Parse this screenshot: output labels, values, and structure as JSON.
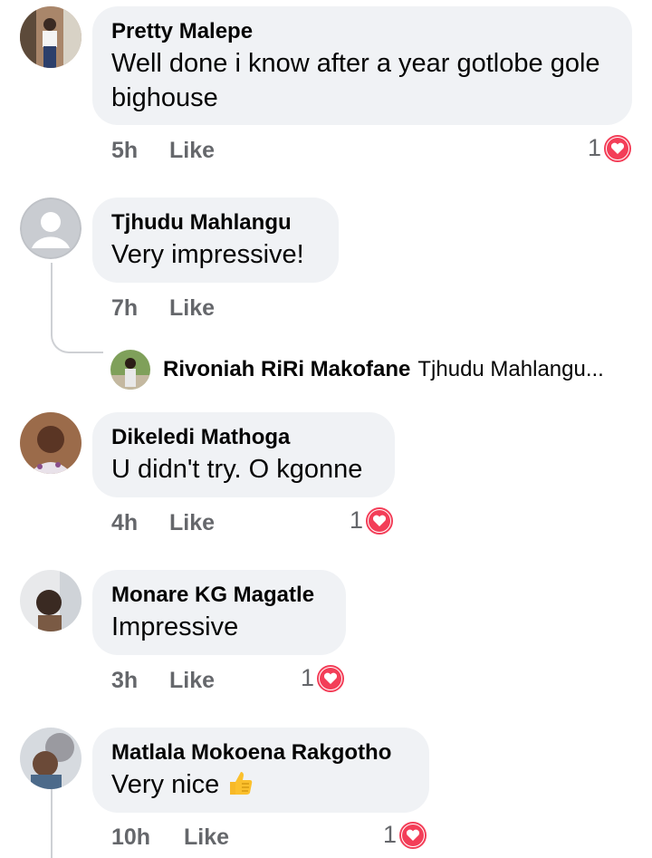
{
  "comments": [
    {
      "name": "Pretty Malepe",
      "text": "Well done i know after a year gotlobe gole bighouse",
      "time": "5h",
      "like": "Like",
      "reactions": "1"
    },
    {
      "name": "Tjhudu Mahlangu",
      "text": "Very impressive!",
      "time": "7h",
      "like": "Like"
    },
    {
      "name": "Dikeledi Mathoga",
      "text": "U didn't try. O kgonne",
      "time": "4h",
      "like": "Like",
      "reactions": "1"
    },
    {
      "name": "Monare KG Magatle",
      "text": "Impressive",
      "time": "3h",
      "like": "Like",
      "reactions": "1"
    },
    {
      "name": "Matlala Mokoena Rakgotho",
      "text": "Very nice",
      "time": "10h",
      "like": "Like",
      "reactions": "1"
    }
  ],
  "reply_preview": {
    "name": "Rivoniah RiRi Makofane",
    "text": "Tjhudu Mahlangu..."
  },
  "icons": {
    "reaction": "love-heart-icon",
    "emoji": "thumbs-up-emoji"
  },
  "colors": {
    "bubble": "#f0f2f5",
    "meta_text": "#65676b",
    "heart": "#f33e58"
  }
}
